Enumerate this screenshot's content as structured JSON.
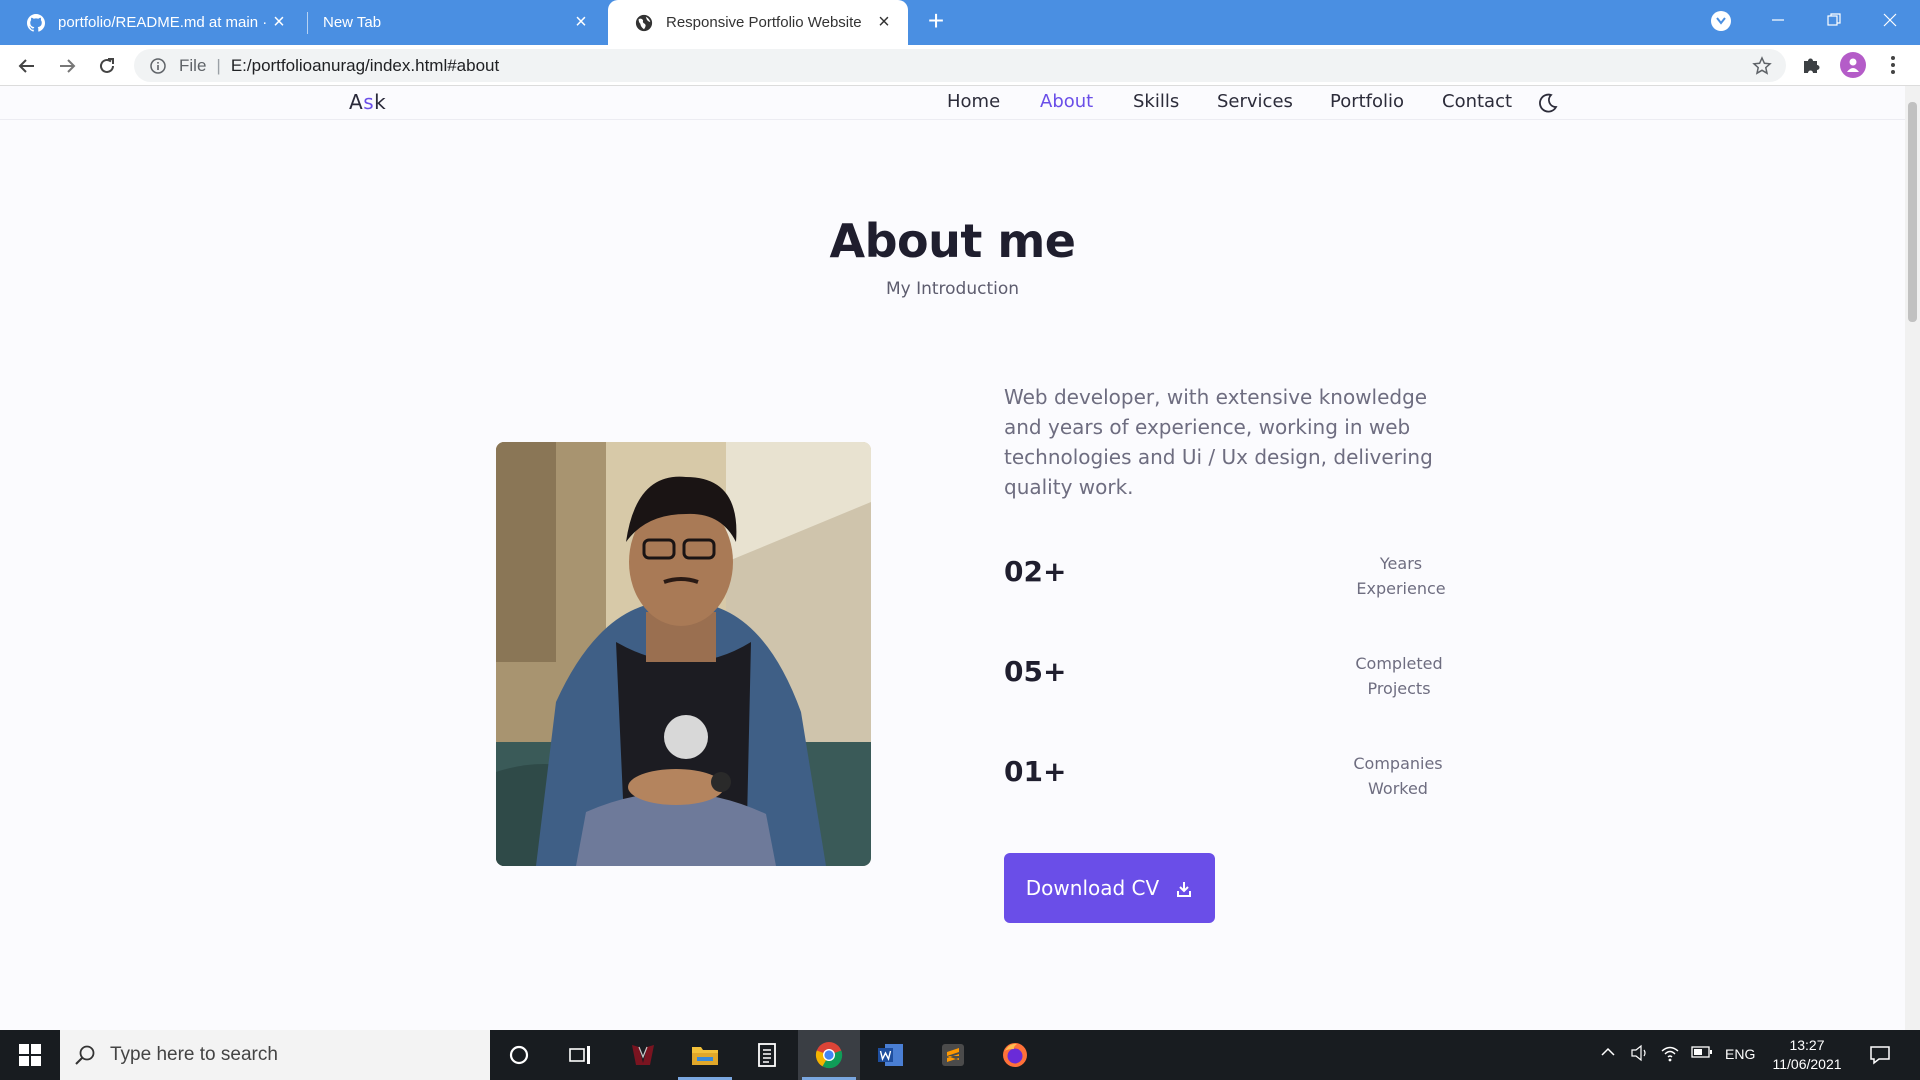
{
  "browser": {
    "tabs": [
      {
        "title": "portfolio/README.md at main · ",
        "icon": "github-icon"
      },
      {
        "title": "New Tab",
        "icon": ""
      },
      {
        "title": "Responsive Portfolio Website",
        "icon": "globe-icon"
      }
    ],
    "address": {
      "scheme_label": "File",
      "url": "E:/portfolioanurag/index.html#about"
    }
  },
  "site": {
    "logo_prefix": "A",
    "logo_accent": "s",
    "logo_suffix": "k",
    "nav": [
      "Home",
      "About",
      "Skills",
      "Services",
      "Portfolio",
      "Contact"
    ],
    "active_nav": "About",
    "accent_color": "#6a4ee8"
  },
  "about": {
    "title": "About me",
    "subtitle": "My Introduction",
    "description": "Web developer, with extensive knowledge and years of experience, working in web technologies and Ui / Ux design, delivering quality work.",
    "stats": [
      {
        "value": "02+",
        "label_line1": "Years",
        "label_line2": "Experience"
      },
      {
        "value": "05+",
        "label_line1": "Completed",
        "label_line2": "Projects"
      },
      {
        "value": "01+",
        "label_line1": "Companies",
        "label_line2": "Worked"
      }
    ],
    "cv_button": "Download CV"
  },
  "taskbar": {
    "search_placeholder": "Type here to search",
    "language": "ENG",
    "time": "13:27",
    "date": "11/06/2021"
  }
}
